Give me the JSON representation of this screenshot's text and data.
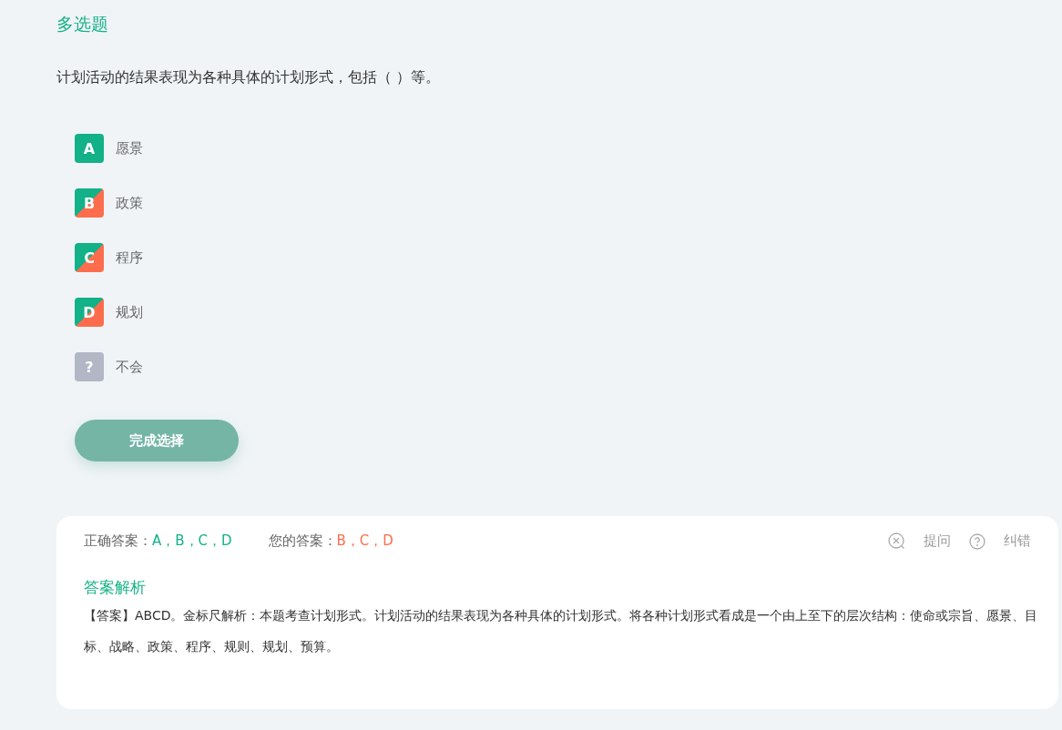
{
  "question_type": "多选题",
  "question": "计划活动的结果表现为各种具体的计划形式，包括（   ）等。",
  "options": [
    {
      "letter": "A",
      "text": "愿景",
      "correct": true,
      "chosen": false
    },
    {
      "letter": "B",
      "text": "政策",
      "correct": true,
      "chosen": true
    },
    {
      "letter": "C",
      "text": "程序",
      "correct": true,
      "chosen": true
    },
    {
      "letter": "D",
      "text": "规划",
      "correct": true,
      "chosen": true
    },
    {
      "letter": "?",
      "text": "不会",
      "correct": false,
      "chosen": false
    }
  ],
  "submit_button": "完成选择",
  "result": {
    "correct_label": "正确答案：",
    "correct_value": "A，B，C，D",
    "your_label": "您的答案：",
    "your_value": "B，C，D",
    "actions": [
      "提问",
      "纠错"
    ],
    "analysis_title": "答案解析",
    "analysis": "【答案】ABCD。金标尺解析：本题考查计划形式。计划活动的结果表现为各种具体的计划形式。将各种计划形式看成是一个由上至下的层次结构：使命或宗旨、愿景、目标、战略、政策、程序、规则、规划、预算。"
  }
}
